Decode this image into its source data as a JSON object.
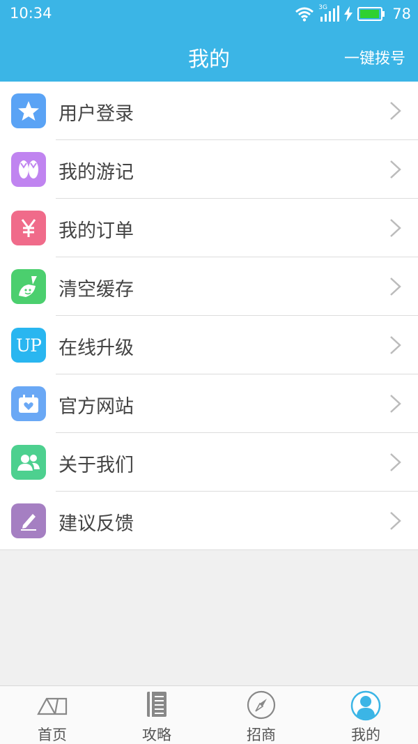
{
  "status_bar": {
    "time": "10:34",
    "network": "3G",
    "battery_level": "78",
    "icons": [
      "wifi-icon",
      "signal-icon",
      "charging-icon",
      "battery-icon"
    ]
  },
  "header": {
    "title": "我的",
    "action_label": "一键拨号",
    "background_color": "#3bb5e6"
  },
  "menu": {
    "items": [
      {
        "label": "用户登录",
        "icon": "star-icon",
        "color": "#5aa3f5"
      },
      {
        "label": "我的游记",
        "icon": "flip-flops-icon",
        "color": "#c084f0"
      },
      {
        "label": "我的订单",
        "icon": "yen-icon",
        "color": "#f06b8a"
      },
      {
        "label": "清空缓存",
        "icon": "broom-icon",
        "color": "#4bcf6e"
      },
      {
        "label": "在线升级",
        "icon": "up-icon",
        "color": "#29b6f0",
        "icon_text": "UP"
      },
      {
        "label": "官方网站",
        "icon": "website-icon",
        "color": "#6aa8f5"
      },
      {
        "label": "关于我们",
        "icon": "people-icon",
        "color": "#4dd08f"
      },
      {
        "label": "建议反馈",
        "icon": "pencil-icon",
        "color": "#a57fc2"
      }
    ]
  },
  "tabbar": {
    "tabs": [
      {
        "label": "首页",
        "icon": "tent-icon",
        "active": false
      },
      {
        "label": "攻略",
        "icon": "book-icon",
        "active": false
      },
      {
        "label": "招商",
        "icon": "compass-icon",
        "active": false
      },
      {
        "label": "我的",
        "icon": "user-icon",
        "active": true
      }
    ]
  }
}
